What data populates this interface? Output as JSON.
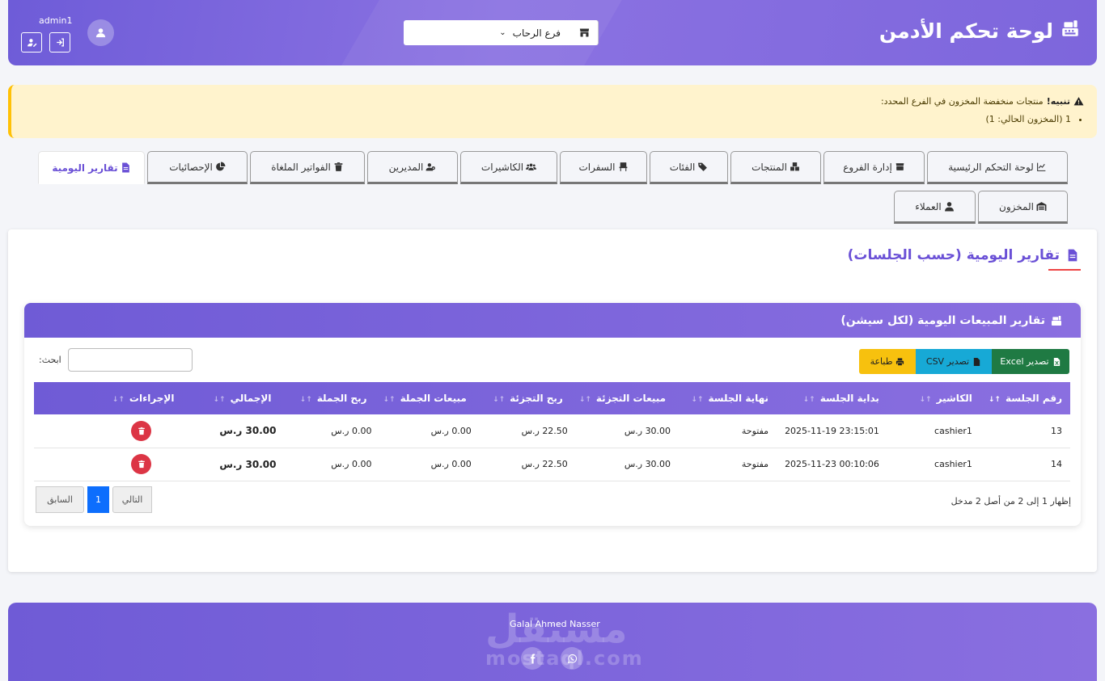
{
  "header": {
    "title": "لوحة تحكم الأدمن",
    "branch_selected": "فرع الرحاب",
    "username": "admin1"
  },
  "alert": {
    "label": "تنبيه!",
    "message": "منتجات منخفضة المخزون في الفرع المحدد:",
    "items": [
      "1 (المخزون الحالي: 1)"
    ]
  },
  "tabs_row1": [
    {
      "label": "لوحة التحكم الرئيسية",
      "icon": "chart-line-icon"
    },
    {
      "label": "إدارة الفروع",
      "icon": "store-icon"
    },
    {
      "label": "المنتجات",
      "icon": "boxes-icon"
    },
    {
      "label": "الفئات",
      "icon": "tags-icon"
    },
    {
      "label": "السفرات",
      "icon": "chair-icon"
    },
    {
      "label": "الكاشيرات",
      "icon": "users-icon"
    },
    {
      "label": "المديرين",
      "icon": "user-tie-icon"
    },
    {
      "label": "الفواتير الملغاة",
      "icon": "trash-icon"
    },
    {
      "label": "الإحصائيات",
      "icon": "pie-chart-icon"
    },
    {
      "label": "تقارير اليومية",
      "icon": "file-icon"
    }
  ],
  "tabs_row2": [
    {
      "label": "المخزون",
      "icon": "warehouse-icon"
    },
    {
      "label": "العملاء",
      "icon": "user-icon"
    }
  ],
  "page": {
    "title": "تقارير اليومية (حسب الجلسات)"
  },
  "report": {
    "title": "تقارير المبيعات اليومية (لكل سيشن)",
    "buttons": {
      "excel": "تصدير Excel",
      "csv": "تصدير CSV",
      "print": "طباعة"
    },
    "search_label": "ابحث:",
    "columns": [
      "رقم الجلسة",
      "الكاشير",
      "بداية الجلسة",
      "نهاية الجلسة",
      "مبيعات التجزئة",
      "ربح التجزئة",
      "مبيعات الجملة",
      "ربح الجملة",
      "الإجمالي",
      "الإجراءات"
    ],
    "rows": [
      {
        "id": "13",
        "cashier": "cashier1",
        "start": "2025-11-19 23:15:01",
        "end": "مفتوحة",
        "retail_sales": "30.00 ر.س",
        "retail_profit": "22.50 ر.س",
        "wholesale_sales": "0.00 ر.س",
        "wholesale_profit": "0.00 ر.س",
        "total": "30.00 ر.س"
      },
      {
        "id": "14",
        "cashier": "cashier1",
        "start": "2025-11-23 00:10:06",
        "end": "مفتوحة",
        "retail_sales": "30.00 ر.س",
        "retail_profit": "22.50 ر.س",
        "wholesale_sales": "0.00 ر.س",
        "wholesale_profit": "0.00 ر.س",
        "total": "30.00 ر.س"
      }
    ],
    "info": "إظهار 1 إلى 2 من أصل 2 مدخل",
    "pager": {
      "prev": "السابق",
      "current": "1",
      "next": "التالي"
    }
  },
  "footer": {
    "name": "Galal Ahmed Nasser",
    "watermark_top": "مستقل",
    "watermark_bottom": "mostaql.com"
  },
  "colors": {
    "primary": "#6f5bd6",
    "primary_light": "#8a6fe0",
    "alert_bg": "#fff3cd",
    "danger": "#dc3545",
    "excel": "#1f7a43",
    "csv": "#17a9d6",
    "print": "#f7c10e"
  }
}
